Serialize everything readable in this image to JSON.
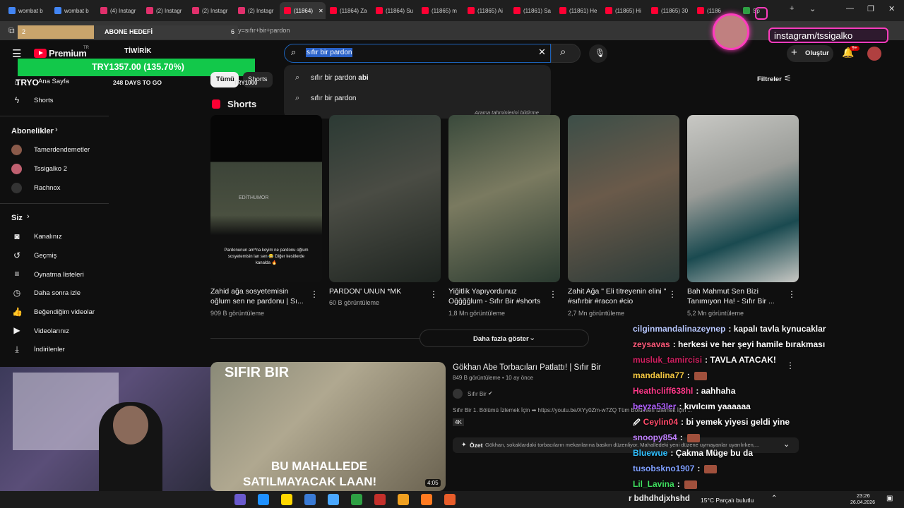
{
  "browser": {
    "tabs": [
      {
        "label": "wombat b",
        "color": "#4285f4"
      },
      {
        "label": "wombat b",
        "color": "#4285f4"
      },
      {
        "label": "(4) Instagr",
        "color": "#e1306c"
      },
      {
        "label": "(2) Instagr",
        "color": "#e1306c"
      },
      {
        "label": "(2) Instagr",
        "color": "#e1306c"
      },
      {
        "label": "(2) Instagr",
        "color": "#e1306c"
      },
      {
        "label": "(11864)",
        "color": "#ff0033"
      },
      {
        "label": "(11864) Za",
        "color": "#ff0033"
      },
      {
        "label": "(11864) Su",
        "color": "#ff0033"
      },
      {
        "label": "(11865) m",
        "color": "#ff0033"
      },
      {
        "label": "(11865) Ai",
        "color": "#ff0033"
      },
      {
        "label": "(11861) Sa",
        "color": "#ff0033"
      },
      {
        "label": "(11861) He",
        "color": "#ff0033"
      },
      {
        "label": "(11865) Hi",
        "color": "#ff0033"
      },
      {
        "label": "(11865) 30",
        "color": "#ff0033"
      },
      {
        "label": "(1186",
        "color": "#ff0033"
      },
      {
        "label": "Sp",
        "color": "#2ea043"
      }
    ],
    "active_tab_index": 6,
    "close_tab": "✕",
    "new_tab": "+",
    "url": "www.youtube.com/results?search_query=sıfır+bir+pardon"
  },
  "overlay": {
    "goal_count": "2",
    "goal_label": "ABONE HEDEFİ",
    "goal_right": "6",
    "twirik": "TİWİRİK",
    "tryo_amount": "TRY1357.00 (135.70%)",
    "tryo_label": "TRYO",
    "tryo_target": "TRY1000",
    "days_to_go": "248 DAYS TO GO",
    "instagram": "instagram/tssigalko"
  },
  "youtube": {
    "premium": "Premium",
    "premium_region": "TR",
    "search_query": "sıfır bir pardon",
    "suggestions": [
      {
        "prefix": "sıfır bir pardon ",
        "bold": "abi"
      },
      {
        "prefix": "sıfır bir pardon",
        "bold": ""
      }
    ],
    "suggest_report": "Arama tahminlerini bildirme",
    "create_label": "Oluştur",
    "notif_badge": "9+",
    "chips": [
      "Tümü",
      "Shorts"
    ],
    "filters_label": "Filtreler",
    "shorts_heading": "Shorts",
    "sidebar": {
      "home": "Ana Sayfa",
      "shorts": "Shorts",
      "subscriptions": "Abonelikler",
      "subs": [
        "Tamerdendemetler",
        "Tssigalko 2",
        "Rachnox"
      ],
      "you": "Siz",
      "you_items": [
        "Kanalınız",
        "Geçmiş",
        "Oynatma listeleri",
        "Daha sonra izle",
        "Beğendiğim videolar",
        "Videolarınız",
        "İndirilenler"
      ]
    },
    "shorts": [
      {
        "title": "Zahid ağa sosyetemisin oğlum sen ne pardonu | Sı...",
        "views": "909 B görüntüleme",
        "overlay_top": "EDİTHUMOR",
        "overlay_bottom": "Pardonunun am*na koyim ne pardonu oğlum sosyetemisin lan sen 😂  Diğer kesitlerde kanalda 🔥"
      },
      {
        "title": "PARDON' UNUN *MK",
        "views": "60 B görüntüleme"
      },
      {
        "title": "Yiğitlik Yapıyordunuz Oğğğğlum - Sıfır Bir #shorts",
        "views": "1,8 Mn görüntüleme"
      },
      {
        "title": "Zahit Ağa \" Eli titreyenin elini \" #sıfırbir #racon #cio",
        "views": "2,7 Mn görüntüleme"
      },
      {
        "title": "Bah Mahmut Sen Bizi Tanımıyon Ha! - Sıfır Bir ...",
        "views": "5,2 Mn görüntüleme"
      }
    ],
    "show_more": "Daha fazla göster",
    "video": {
      "title": "Gökhan Abe Torbacıları Patlattı! | Sıfır Bir",
      "meta": "849 B görüntüleme • 10 ay önce",
      "channel": "Sıfır Bir",
      "desc": "Sıfır Bir 1. Bölümü İzlemek İçin ➡ https://youtu.be/XYy0Zm-w7ZQ Tüm Bölümleri İzlemek İçin ...",
      "badge": "4K",
      "summary_label": "Özet",
      "summary": "Gökhan, sokaklardaki torbacıların mekanlarına baskın düzenliyor. Mahalledeki yeni düzene uymayanlar uyarılırken,...",
      "thumb_brand": "SIFIR BIR",
      "thumb_line1": "BU MAHALLEDE",
      "thumb_line2": "SATILMAYACAK LAAN!",
      "duration": "4:05"
    }
  },
  "chat": [
    {
      "user": "cilginmandalinazeynep",
      "color": "#b9c8ff",
      "msg": ": kapalı tavla kynucaklar"
    },
    {
      "user": "zeysavas",
      "color": "#ff5a7a",
      "msg": ": herkesi ve her şeyi hamile bırakması"
    },
    {
      "user": "musluk_tamircisi",
      "color": "#d02060",
      "msg": ": TAVLA ATACAK!"
    },
    {
      "user": "mandalina77",
      "color": "#f5c842",
      "msg": ":",
      "emote": true
    },
    {
      "user": "Heathcliff638hl",
      "color": "#ff3a8a",
      "msg": ": aahhaha"
    },
    {
      "user": "beyza53ler",
      "color": "#b060ff",
      "msg": ": kıvılcım yaaaaaa"
    },
    {
      "user": "Ceylin04",
      "color": "#ff4a6a",
      "msg": ": bi yemek yiyesi geldi yine",
      "badge": "🖉"
    },
    {
      "user": "snoopy854",
      "color": "#c080ff",
      "msg": ":",
      "emote": true
    },
    {
      "user": "Bluewue",
      "color": "#30c0ff",
      "msg": ": Çakma Müge bu da"
    },
    {
      "user": "tusobskno1907",
      "color": "#80a0ff",
      "msg": ":",
      "emote": true
    },
    {
      "user": "Lil_Lavina",
      "color": "#40e060",
      "msg": ":",
      "emote": true
    }
  ],
  "taskbar": {
    "chat_partial": "r bdhdhdjxhshd",
    "weather": "15°C  Parçalı bulutlu",
    "time": "23:26",
    "date": "26.04.2026"
  }
}
